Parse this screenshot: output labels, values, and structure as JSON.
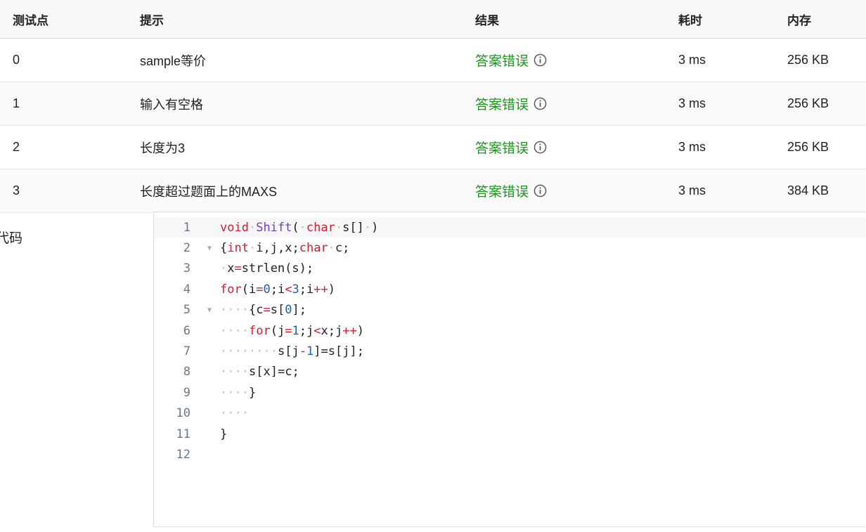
{
  "table": {
    "headers": [
      "测试点",
      "提示",
      "结果",
      "耗时",
      "内存"
    ],
    "rows": [
      {
        "id": "0",
        "hint": "sample等价",
        "result": "答案错误",
        "time": "3 ms",
        "memory": "256 KB"
      },
      {
        "id": "1",
        "hint": "输入有空格",
        "result": "答案错误",
        "time": "3 ms",
        "memory": "256 KB"
      },
      {
        "id": "2",
        "hint": "长度为3",
        "result": "答案错误",
        "time": "3 ms",
        "memory": "256 KB"
      },
      {
        "id": "3",
        "hint": "长度超过题面上的MAXS",
        "result": "答案错误",
        "time": "3 ms",
        "memory": "384 KB"
      }
    ]
  },
  "code_section": {
    "label": "代码",
    "line_numbers": [
      "1",
      "2",
      "3",
      "4",
      "5",
      "6",
      "7",
      "8",
      "9",
      "10",
      "11",
      "12"
    ],
    "lines": [
      "void Shift( char s[] )",
      "{int i,j,x;char c;",
      " x=strlen(s);",
      "for(i=0;i<3;i++)",
      "    {c=s[0];",
      "    for(j=1;j<x;j++)",
      "        s[j-1]=s[j];",
      "    s[x]=c;",
      "    }",
      "    ",
      "}",
      ""
    ]
  },
  "colors": {
    "status_ok": "#1a9a1a",
    "keyword": "#d2202f",
    "function": "#6f42c1",
    "number": "#1f5fb8"
  },
  "icons": [
    "info-icon",
    "fold-arrow-icon"
  ]
}
